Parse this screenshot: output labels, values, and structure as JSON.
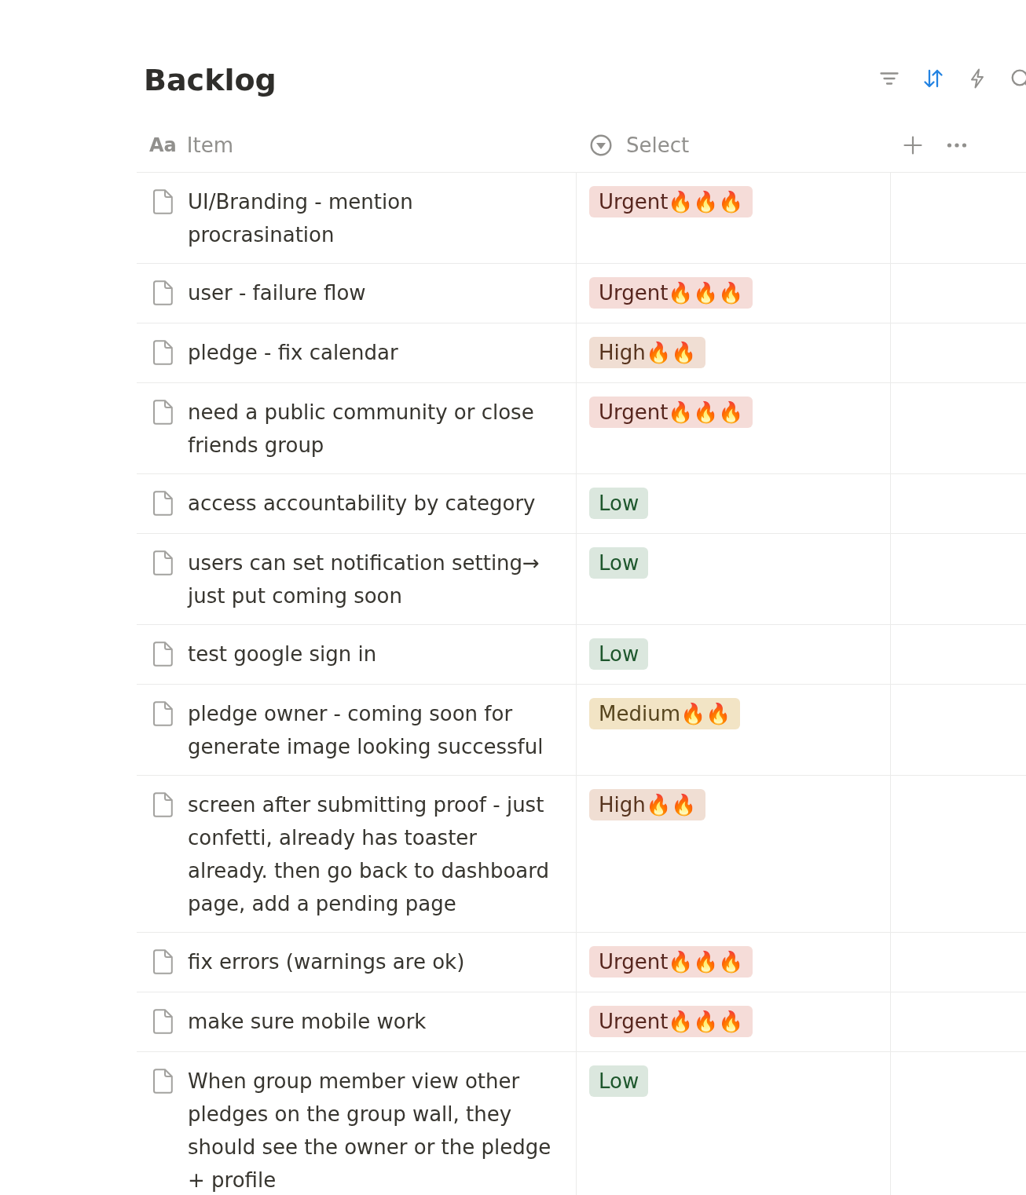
{
  "title": "Backlog",
  "toolbar": [
    {
      "kind": "filter",
      "active": false
    },
    {
      "kind": "sort",
      "active": true
    },
    {
      "kind": "automation",
      "active": false
    },
    {
      "kind": "search",
      "active": false
    }
  ],
  "table": {
    "columns": [
      {
        "kind": "title",
        "icon_text": "Aa",
        "label": "Item"
      },
      {
        "kind": "select",
        "label": "Select"
      }
    ],
    "header_actions": [
      {
        "kind": "add"
      },
      {
        "kind": "more"
      }
    ],
    "rows": [
      {
        "item": "UI/Branding - mention procrasination",
        "select": {
          "label": "Urgent🔥🔥🔥",
          "color": "#f5dcd8"
        }
      },
      {
        "item": "user - failure flow",
        "select": {
          "label": "Urgent🔥🔥🔥",
          "color": "#f5dcd8"
        }
      },
      {
        "item": "pledge - fix calendar",
        "select": {
          "label": "High🔥🔥",
          "color": "#f0ded3"
        }
      },
      {
        "item": "need a public community or close friends group",
        "select": {
          "label": "Urgent🔥🔥🔥",
          "color": "#f5dcd8"
        }
      },
      {
        "item": "access accountability by category",
        "select": {
          "label": "Low",
          "color": "#dbe7de"
        }
      },
      {
        "item": "users can set notification setting→ just put coming soon",
        "select": {
          "label": "Low",
          "color": "#dbe7de"
        }
      },
      {
        "item": "test google sign in",
        "select": {
          "label": "Low",
          "color": "#dbe7de"
        }
      },
      {
        "item": "pledge owner - coming soon for generate image looking successful",
        "select": {
          "label": "Medium🔥🔥",
          "color": "#f2e4c5"
        }
      },
      {
        "item": "screen after submitting proof - just confetti, already has toaster already. then go back to dashboard page, add a pending page",
        "select": {
          "label": "High🔥🔥",
          "color": "#f0ded3"
        }
      },
      {
        "item": "fix errors (warnings are ok)",
        "select": {
          "label": "Urgent🔥🔥🔥",
          "color": "#f5dcd8"
        }
      },
      {
        "item": "make sure mobile work",
        "select": {
          "label": "Urgent🔥🔥🔥",
          "color": "#f5dcd8"
        }
      },
      {
        "item": "When group member view other pledges on the group wall, they should see the owner or the pledge + profile",
        "select": {
          "label": "Low",
          "color": "#dbe7de"
        }
      }
    ]
  }
}
